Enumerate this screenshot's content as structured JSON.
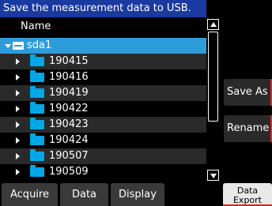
{
  "title": "Save the measurement data to USB.",
  "list_header": "Name",
  "tree": {
    "root": "sda1",
    "folders": [
      "190415",
      "190416",
      "190419",
      "190422",
      "190423",
      "190424",
      "190507",
      "190509"
    ]
  },
  "side_buttons": {
    "save_as": "Save As",
    "rename": "Rename"
  },
  "tabs": {
    "acquire": "Acquire",
    "data": "Data",
    "display": "Display",
    "data_export": "Data Export"
  },
  "colors": {
    "title_bg": "#1a3aa0",
    "selected": "#2d9cdb",
    "folder": "#00a8e6",
    "accent": "#d9262b"
  }
}
